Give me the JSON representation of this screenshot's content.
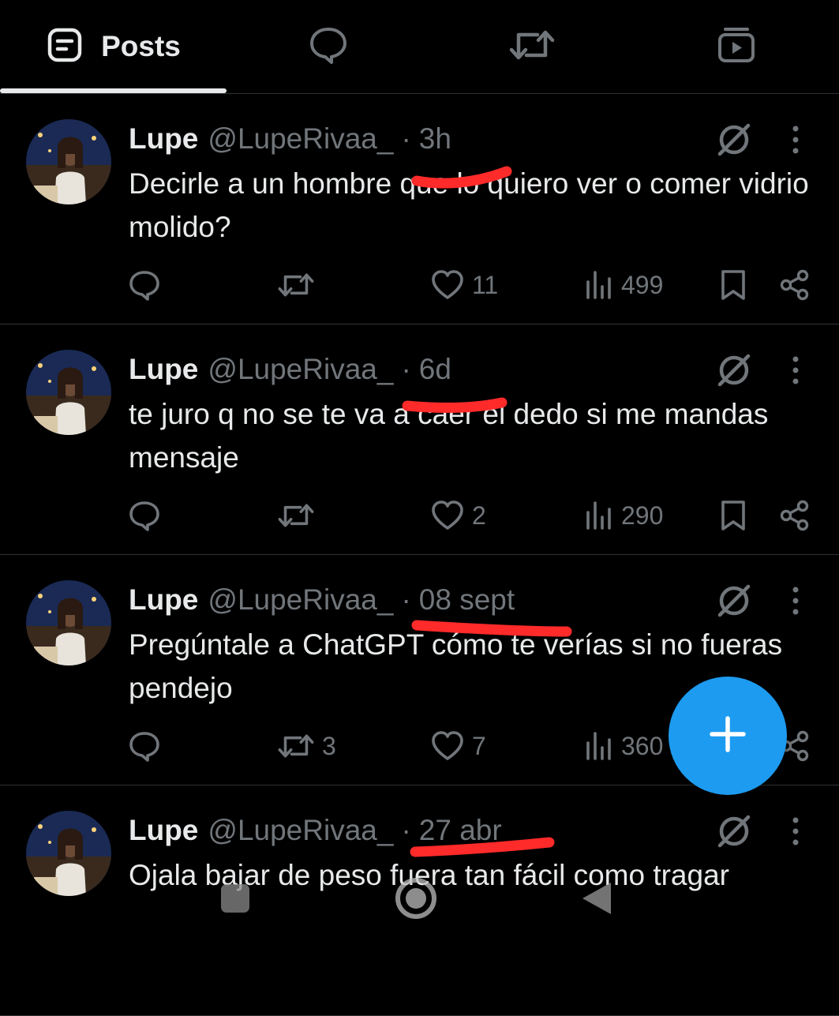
{
  "tabs": {
    "posts_label": "Posts",
    "items": [
      {
        "name": "posts",
        "icon": "posts-icon",
        "active": true
      },
      {
        "name": "replies",
        "icon": "speech-bubble-icon"
      },
      {
        "name": "reposts",
        "icon": "repost-icon"
      },
      {
        "name": "media",
        "icon": "video-icon"
      }
    ]
  },
  "posts": [
    {
      "name": "Lupe",
      "handle": "@LupeRivaa_",
      "dot": "·",
      "time": "3h",
      "text": "Decirle a un hombre que lo quiero ver o comer vidrio molido?",
      "replies": "",
      "reposts": "",
      "likes": "11",
      "views": "499"
    },
    {
      "name": "Lupe",
      "handle": "@LupeRivaa_",
      "dot": "·",
      "time": "6d",
      "text": "te juro q no se te va a caer el dedo si me mandas mensaje",
      "replies": "",
      "reposts": "",
      "likes": "2",
      "views": "290"
    },
    {
      "name": "Lupe",
      "handle": "@LupeRivaa_",
      "dot": "·",
      "time": "08 sept",
      "text": "Pregúntale a ChatGPT cómo te verías si no fueras pendejo",
      "replies": "",
      "reposts": "3",
      "likes": "7",
      "views": "360"
    },
    {
      "name": "Lupe",
      "handle": "@LupeRivaa_",
      "dot": "·",
      "time": "27 abr",
      "text": "Ojala bajar de peso fuera tan fácil como tragar",
      "replies": "",
      "reposts": "",
      "likes": "",
      "views": ""
    }
  ],
  "colors": {
    "background": "#000000",
    "text_primary": "#e7e9ea",
    "text_secondary": "#71767b",
    "divider": "#2f3336",
    "accent": "#1d9bf0",
    "redaction": "#ff2a2a"
  },
  "fab": {
    "icon": "plus-icon"
  },
  "system_nav": {
    "icons": [
      "recents-icon",
      "home-icon",
      "back-icon"
    ]
  }
}
